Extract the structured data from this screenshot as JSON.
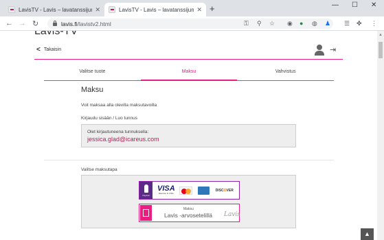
{
  "browser": {
    "tabs": [
      {
        "title": "LavisTV - Lavis – lavatanssijumpp"
      },
      {
        "title": "LavisTV - Lavis – lavatanssijumpp"
      }
    ],
    "url_domain": "lavis.fi",
    "url_path": "/lavistv2.html"
  },
  "header": {
    "brand": "Lavis-TV",
    "back_label": "Takaisin"
  },
  "steps": [
    {
      "label": "Valitse tuote",
      "active": false
    },
    {
      "label": "Maksu",
      "active": true
    },
    {
      "label": "Vahvistus",
      "active": false
    }
  ],
  "main": {
    "title": "Maksu",
    "intro": "Voit maksaa alla olevilla maksutavoilla",
    "login_label": "Kirjaudu sisään / Luo tunnus",
    "logged_in_text": "Olet kirjautuneena tunnuksella:",
    "email": "jessica.glad@icareus.com",
    "payment_label": "Valitse maksutapa"
  },
  "payment_options": {
    "card": {
      "paytrail": "Paytrail",
      "visa": "VISA",
      "visa_sub": "Electron & VISA",
      "discover_a": "DISC",
      "discover_b": "O",
      "discover_c": "VER"
    },
    "voucher": {
      "small": "Maksu",
      "big": "Lavis -arvosetelillä",
      "script": "Lavis"
    }
  },
  "colors": {
    "accent": "#e91e80",
    "email": "#c2185b",
    "paytrail": "#5b2a86"
  }
}
